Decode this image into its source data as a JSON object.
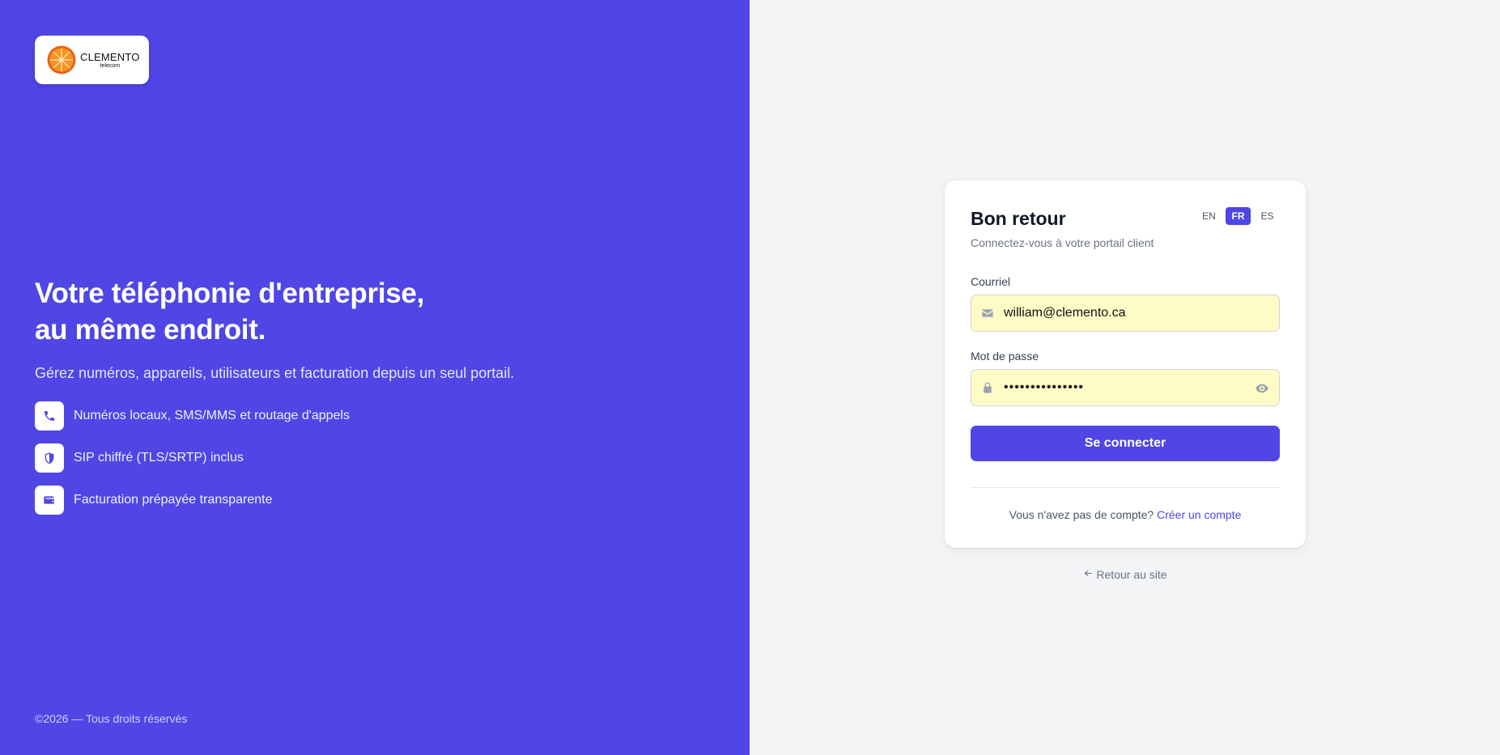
{
  "brand": {
    "name": "CLEMENTO",
    "tagline": "telecom"
  },
  "hero": {
    "title_line1": "Votre téléphonie d'entreprise,",
    "title_line2": "au même endroit.",
    "subtitle": "Gérez numéros, appareils, utilisateurs et facturation depuis un seul portail."
  },
  "features": [
    {
      "icon": "phone-icon",
      "label": "Numéros locaux, SMS/MMS et routage d'appels"
    },
    {
      "icon": "shield-icon",
      "label": "SIP chiffré (TLS/SRTP) inclus"
    },
    {
      "icon": "wallet-icon",
      "label": "Facturation prépayée transparente"
    }
  ],
  "footer": {
    "copyright": "©2026 — Tous droits réservés"
  },
  "login": {
    "title": "Bon retour",
    "subtitle": "Connectez-vous à votre portail client",
    "languages": [
      {
        "code": "EN",
        "active": false
      },
      {
        "code": "FR",
        "active": true
      },
      {
        "code": "ES",
        "active": false
      }
    ],
    "email_label": "Courriel",
    "email_value": "william@clemento.ca",
    "password_label": "Mot de passe",
    "password_value": "•••••••••••••••",
    "submit_label": "Se connecter",
    "no_account_text": "Vous n'avez pas de compte?",
    "create_account_link": "Créer un compte"
  },
  "back_link": "Retour au site",
  "colors": {
    "accent": "#4f46e5",
    "panel_bg": "#f3f4f6",
    "input_autofill": "#fefbc7"
  }
}
